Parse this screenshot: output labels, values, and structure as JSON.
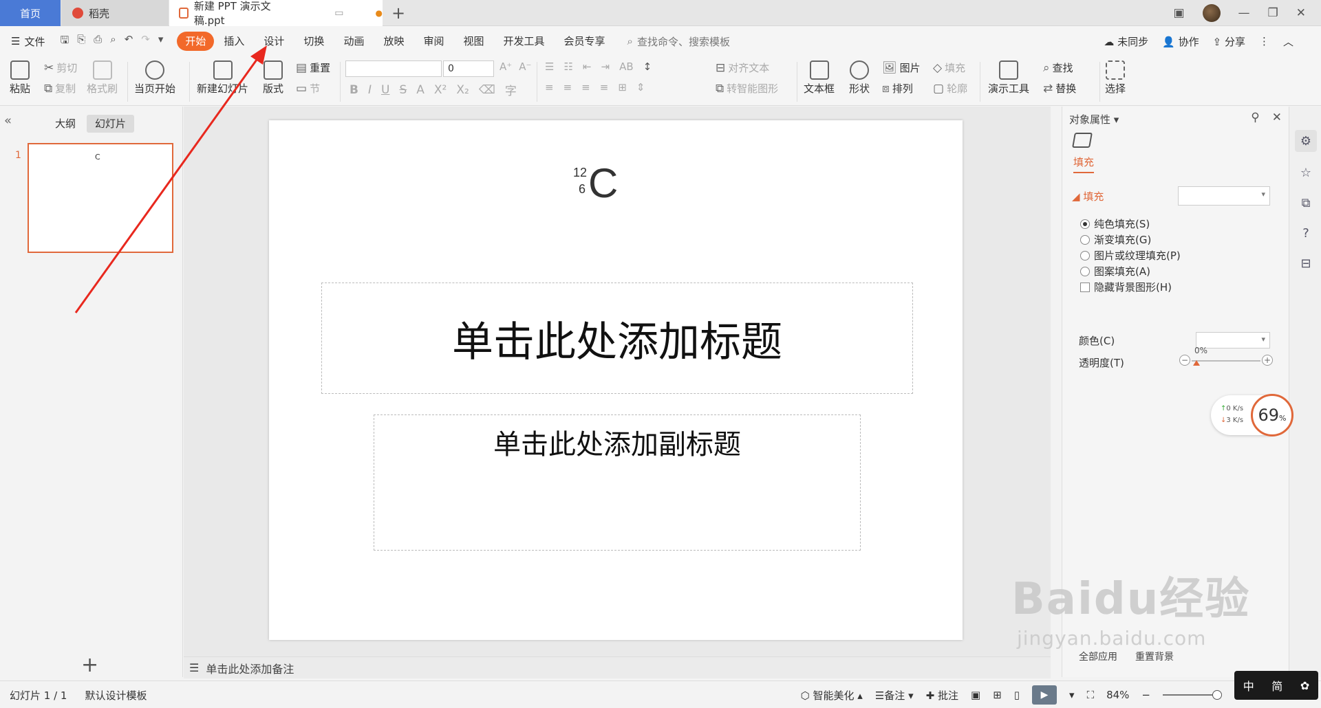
{
  "tabs": {
    "home": "首页",
    "docer": "稻壳",
    "document": "新建 PPT 演示文稿.ppt",
    "add": "+"
  },
  "menu": {
    "file": "文件",
    "tabs": [
      "开始",
      "插入",
      "设计",
      "切换",
      "动画",
      "放映",
      "审阅",
      "视图",
      "开发工具",
      "会员专享"
    ],
    "search_placeholder": "查找命令、搜索模板",
    "right": {
      "sync": "未同步",
      "collab": "协作",
      "share": "分享"
    }
  },
  "ribbon": {
    "paste": "粘贴",
    "cut": "剪切",
    "copy": "复制",
    "format_painter": "格式刷",
    "from_current": "当页开始",
    "new_slide": "新建幻灯片",
    "layout": "版式",
    "reset": "重置",
    "section": "节",
    "font_name": "",
    "font_size": "0",
    "align_text": "对齐文本",
    "smartart": "转智能图形",
    "textbox": "文本框",
    "shapes": "形状",
    "picture": "图片",
    "fill": "填充",
    "arrange": "排列",
    "outline": "轮廓",
    "presenter_tools": "演示工具",
    "find": "查找",
    "replace": "替换",
    "select": "选择"
  },
  "left_panel": {
    "tab_outline": "大纲",
    "tab_slides": "幻灯片",
    "slide_number": "1",
    "thumb_text": "C"
  },
  "slide": {
    "nuclide": {
      "mass": "12",
      "atomic": "6",
      "symbol": "C"
    },
    "title_placeholder": "单击此处添加标题",
    "subtitle_placeholder": "单击此处添加副标题"
  },
  "notes_placeholder": "单击此处添加备注",
  "properties": {
    "panel_title": "对象属性",
    "tab_fill": "填充",
    "section_fill": "填充",
    "options": [
      "纯色填充(S)",
      "渐变填充(G)",
      "图片或纹理填充(P)",
      "图案填充(A)"
    ],
    "hide_bg": "隐藏背景图形(H)",
    "color_label": "颜色(C)",
    "transparency_label": "透明度(T)",
    "transparency_value": "0%",
    "apply_all": "全部应用",
    "reset_bg": "重置背景"
  },
  "netmon": {
    "up": "0 K/s",
    "down": "3 K/s",
    "percent": "69",
    "unit": "%"
  },
  "statusbar": {
    "slide_info": "幻灯片 1 / 1",
    "template": "默认设计模板",
    "beautify": "智能美化",
    "notes": "备注",
    "comments": "批注",
    "zoom": "84%"
  },
  "ime": {
    "lang": "中",
    "mode": "简"
  },
  "watermark": {
    "main": "Baidu经验",
    "sub": "jingyan.baidu.com"
  },
  "colors": {
    "accent": "#e0683a",
    "home_tab": "#4a7ad6",
    "arrow": "#e8281e"
  }
}
